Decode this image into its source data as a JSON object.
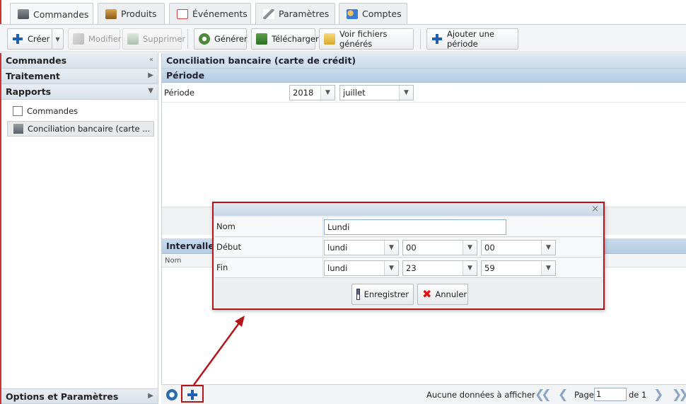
{
  "tabs": [
    {
      "label": "Commandes",
      "icon": "register-icon",
      "active": true
    },
    {
      "label": "Produits",
      "icon": "box-icon"
    },
    {
      "label": "Événements",
      "icon": "calendar-icon"
    },
    {
      "label": "Paramètres",
      "icon": "wrench-icon"
    },
    {
      "label": "Comptes",
      "icon": "users-icon"
    }
  ],
  "toolbar": {
    "create": "Créer",
    "modify": "Modifier",
    "delete": "Supprimer",
    "generate": "Générer",
    "download": "Télécharger",
    "view_files": "Voir fichiers générés",
    "add_period": "Ajouter une période"
  },
  "sidebar": {
    "sections": [
      {
        "label": "Commandes",
        "arrow": "«"
      },
      {
        "label": "Traitement",
        "arrow": "▶"
      },
      {
        "label": "Rapports",
        "arrow": "▼"
      }
    ],
    "items": [
      {
        "label": "Commandes"
      },
      {
        "label": "Conciliation bancaire (carte ..."
      }
    ],
    "footer": {
      "label": "Options et Paramètres",
      "arrow": "▶"
    }
  },
  "main": {
    "title": "Conciliation bancaire (carte de crédit)",
    "period_section": "Période",
    "period_label": "Période",
    "year": "2018",
    "month": "juillet",
    "intervals_title": "Intervalles",
    "grid_col_name": "Nom"
  },
  "pager": {
    "empty_text": "Aucune données à afficher",
    "page_label": "Page",
    "page_value": "1",
    "of_label": "de 1"
  },
  "dialog": {
    "close": "×",
    "name_label": "Nom",
    "name_value": "Lundi",
    "start_label": "Début",
    "start_day": "lundi",
    "start_hour": "00",
    "start_min": "00",
    "end_label": "Fin",
    "end_day": "lundi",
    "end_hour": "23",
    "end_min": "59",
    "save": "Enregistrer",
    "cancel": "Annuler"
  },
  "colors": {
    "accent_red": "#b3151b",
    "header_blue": "#cddcea",
    "plus_blue": "#1e5fb3"
  }
}
